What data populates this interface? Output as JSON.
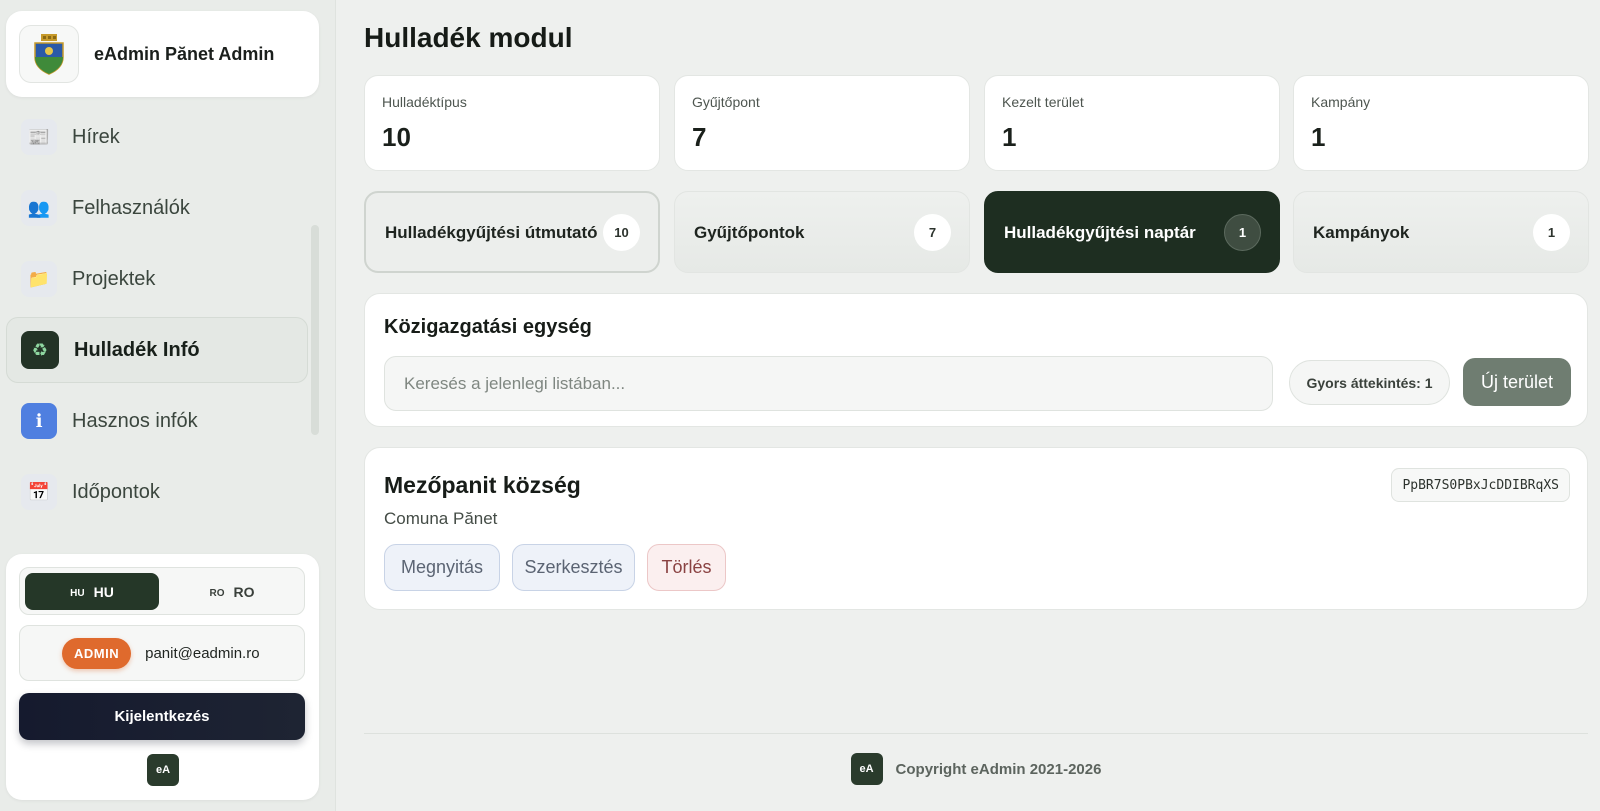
{
  "sidebar": {
    "brand_title": "eAdmin Pănet Admin",
    "items": [
      {
        "label": "Hírek",
        "icon": "newspaper-icon",
        "glyph": "📰"
      },
      {
        "label": "Felhasználók",
        "icon": "users-icon",
        "glyph": "👥"
      },
      {
        "label": "Projektek",
        "icon": "folder-icon",
        "glyph": "📁"
      },
      {
        "label": "Hulladék Infó",
        "icon": "recycle-icon",
        "glyph": "♻"
      },
      {
        "label": "Hasznos infók",
        "icon": "info-icon",
        "glyph": "ℹ"
      },
      {
        "label": "Időpontok",
        "icon": "calendar-icon",
        "glyph": "📅"
      }
    ],
    "language": {
      "hu_code": "HU",
      "hu_label": "HU",
      "ro_code": "RO",
      "ro_label": "RO",
      "active": "HU"
    },
    "user": {
      "badge": "ADMIN",
      "email": "panit@eadmin.ro"
    },
    "logout_label": "Kijelentkezés",
    "small_logo": "eA"
  },
  "main": {
    "title": "Hulladék modul",
    "stats": [
      {
        "label": "Hulladéktípus",
        "value": "10"
      },
      {
        "label": "Gyűjtőpont",
        "value": "7"
      },
      {
        "label": "Kezelt terület",
        "value": "1"
      },
      {
        "label": "Kampány",
        "value": "1"
      }
    ],
    "tabs": [
      {
        "label": "Hulladékgyűjtési útmutató",
        "count": "10"
      },
      {
        "label": "Gyűjtőpontok",
        "count": "7"
      },
      {
        "label": "Hulladékgyűjtési naptár",
        "count": "1"
      },
      {
        "label": "Kampányok",
        "count": "1"
      }
    ],
    "active_tab": "Hulladékgyűjtési naptár",
    "unit_section": {
      "title": "Közigazgatási egység",
      "search_placeholder": "Keresés a jelenlegi listában...",
      "quick_overview": "Gyors áttekintés: 1",
      "new_button": "Új terület"
    },
    "item": {
      "title": "Mezőpanit község",
      "subtitle": "Comuna Pănet",
      "code": "PpBR7S0PBxJcDDIBRqXS",
      "actions": {
        "open": "Megnyitás",
        "edit": "Szerkesztés",
        "delete": "Törlés"
      }
    },
    "footer": {
      "logo": "eA",
      "text": "Copyright eAdmin 2021-2026"
    }
  },
  "colors": {
    "accent_dark": "#1e2e21",
    "admin_badge": "#df6a2d",
    "logout": "#151a2e",
    "new_button": "#6f7d71"
  }
}
